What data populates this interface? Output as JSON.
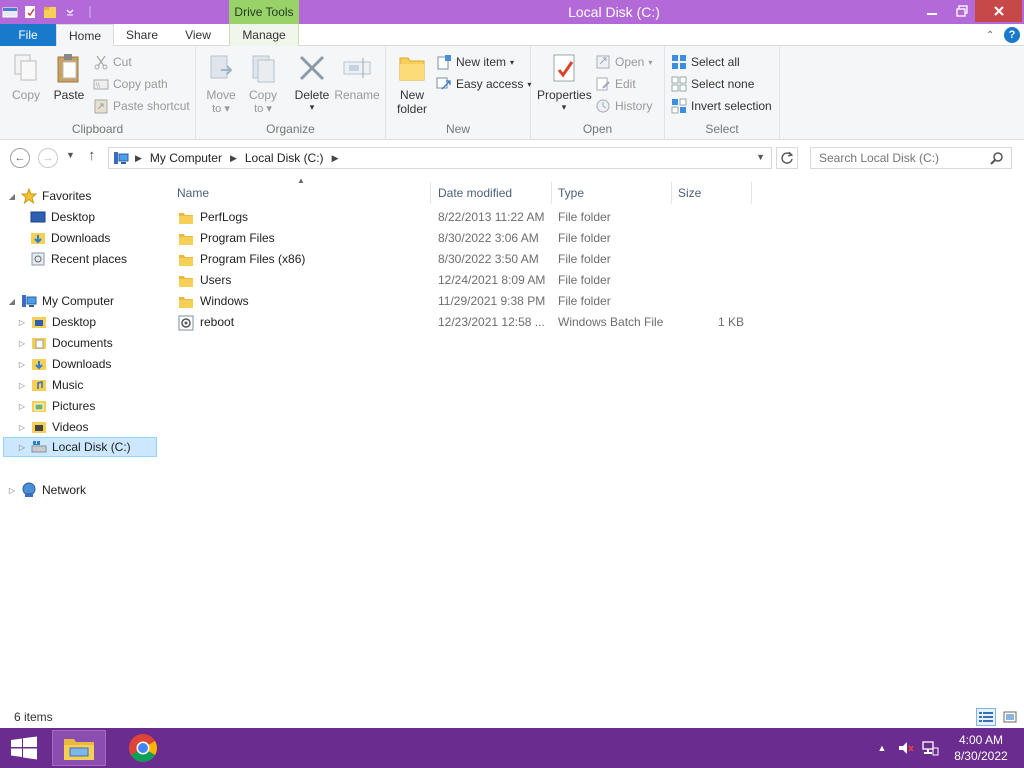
{
  "window": {
    "title": "Local Disk (C:)",
    "contextual_tab": "Drive Tools"
  },
  "tabs": {
    "file": "File",
    "home": "Home",
    "share": "Share",
    "view": "View",
    "manage": "Manage",
    "help": "?"
  },
  "ribbon": {
    "clipboard": {
      "label": "Clipboard",
      "copy": "Copy",
      "paste": "Paste",
      "cut": "Cut",
      "copy_path": "Copy path",
      "paste_shortcut": "Paste shortcut"
    },
    "organize": {
      "label": "Organize",
      "move_to_line1": "Move",
      "move_to_line2": "to",
      "copy_to_line1": "Copy",
      "copy_to_line2": "to",
      "delete": "Delete",
      "rename": "Rename"
    },
    "new": {
      "label": "New",
      "new_folder_line1": "New",
      "new_folder_line2": "folder",
      "new_item": "New item",
      "easy_access": "Easy access"
    },
    "open": {
      "label": "Open",
      "properties": "Properties",
      "open": "Open",
      "edit": "Edit",
      "history": "History"
    },
    "select": {
      "label": "Select",
      "select_all": "Select all",
      "select_none": "Select none",
      "invert_selection": "Invert selection"
    }
  },
  "address": {
    "crumbs": [
      "My Computer",
      "Local Disk (C:)"
    ],
    "search_placeholder": "Search Local Disk (C:)"
  },
  "nav": {
    "favorites": "Favorites",
    "fav_items": [
      "Desktop",
      "Downloads",
      "Recent places"
    ],
    "my_computer": "My Computer",
    "pc_items": [
      "Desktop",
      "Documents",
      "Downloads",
      "Music",
      "Pictures",
      "Videos",
      "Local Disk (C:)"
    ],
    "network": "Network"
  },
  "columns": {
    "name": "Name",
    "date": "Date modified",
    "type": "Type",
    "size": "Size"
  },
  "files": [
    {
      "name": "PerfLogs",
      "date": "8/22/2013 11:22 AM",
      "type": "File folder",
      "size": ""
    },
    {
      "name": "Program Files",
      "date": "8/30/2022 3:06 AM",
      "type": "File folder",
      "size": ""
    },
    {
      "name": "Program Files (x86)",
      "date": "8/30/2022 3:50 AM",
      "type": "File folder",
      "size": ""
    },
    {
      "name": "Users",
      "date": "12/24/2021 8:09 AM",
      "type": "File folder",
      "size": ""
    },
    {
      "name": "Windows",
      "date": "11/29/2021 9:38 PM",
      "type": "File folder",
      "size": ""
    },
    {
      "name": "reboot",
      "date": "12/23/2021 12:58 ...",
      "type": "Windows Batch File",
      "size": "1 KB"
    }
  ],
  "status": {
    "item_count": "6 items"
  },
  "taskbar": {
    "time": "4:00 AM",
    "date": "8/30/2022"
  },
  "colors": {
    "titlebar": "#b36ad8",
    "taskbar": "#6b2c8f",
    "file_tab": "#1979ca",
    "drive_tools": "#9ad26a",
    "selection": "#cce8ff"
  }
}
